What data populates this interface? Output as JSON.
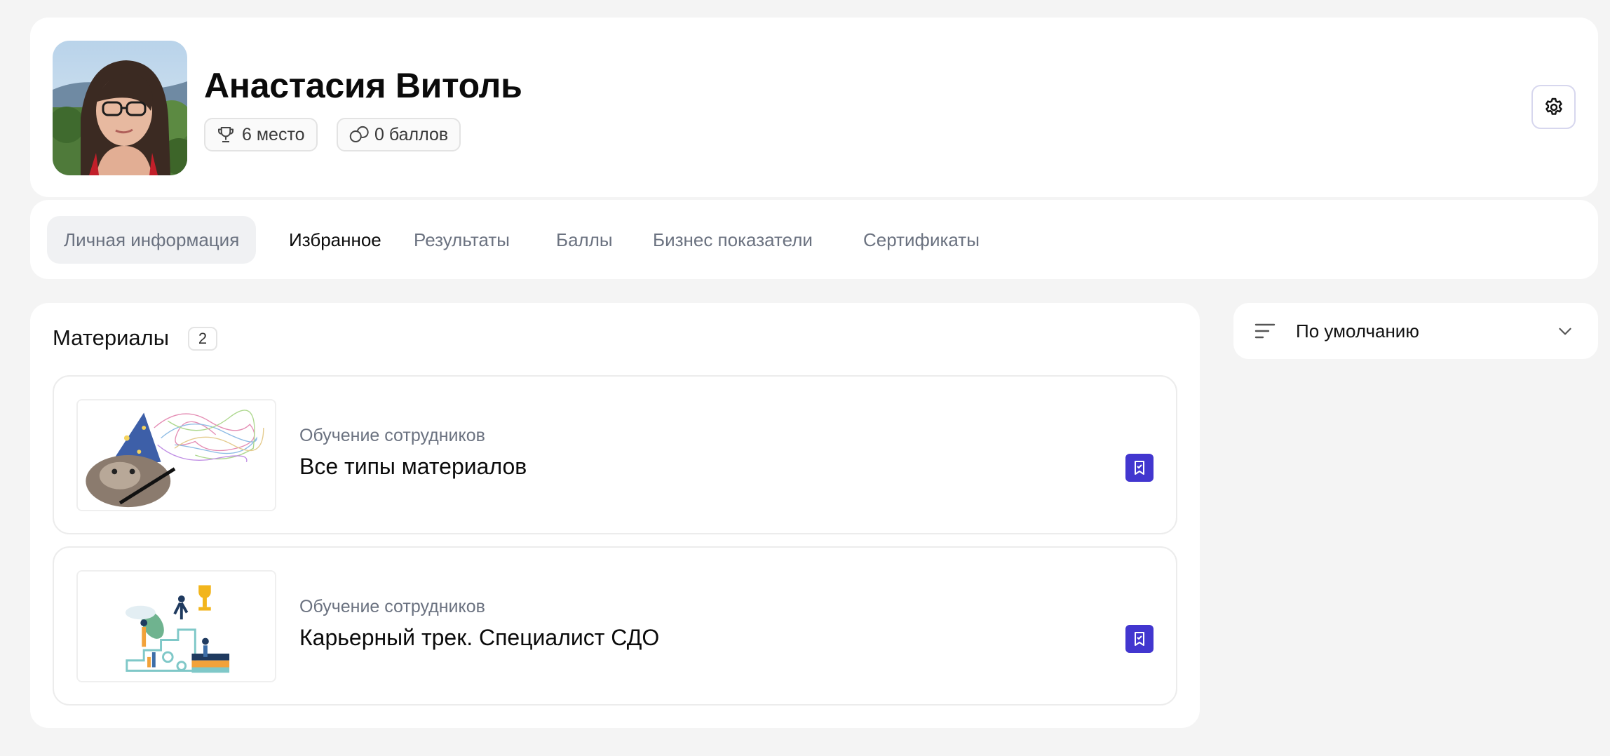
{
  "profile": {
    "name": "Анастасия Витоль",
    "rank_label": "6 место",
    "points_label": "0 баллов"
  },
  "tabs": [
    {
      "label": "Личная информация"
    },
    {
      "label": "Избранное"
    },
    {
      "label": "Результаты"
    },
    {
      "label": "Баллы"
    },
    {
      "label": "Бизнес показатели"
    },
    {
      "label": "Сертификаты"
    }
  ],
  "materials": {
    "title": "Материалы",
    "count": "2",
    "items": [
      {
        "category": "Обучение сотрудников",
        "title": "Все типы материалов"
      },
      {
        "category": "Обучение сотрудников",
        "title": "Карьерный трек. Специалист СДО"
      }
    ]
  },
  "sort": {
    "label": "По умолчанию"
  },
  "colors": {
    "accent": "#4236cf",
    "background": "#f4f4f4",
    "card": "#ffffff"
  }
}
